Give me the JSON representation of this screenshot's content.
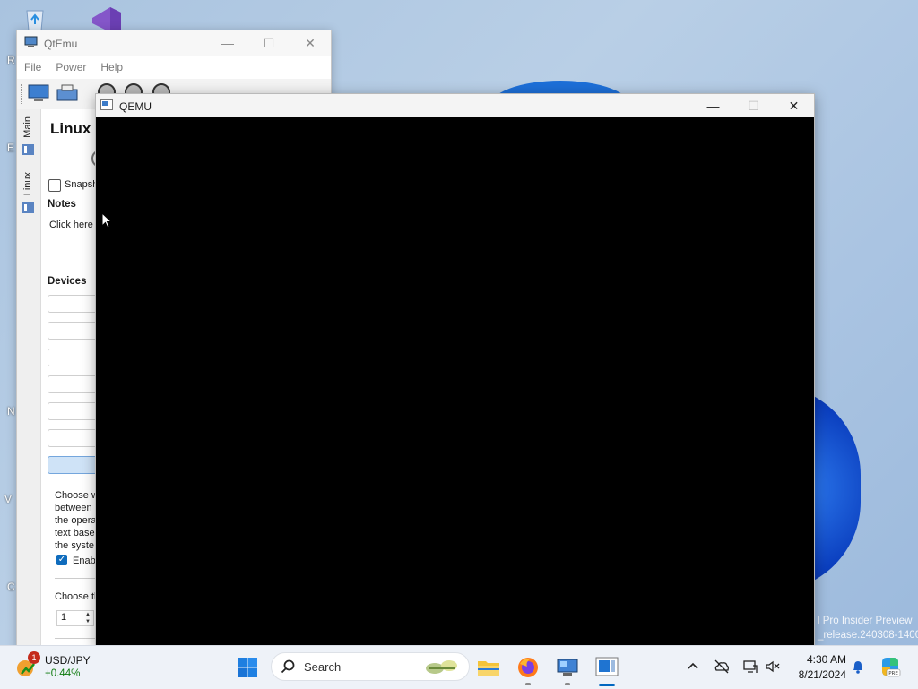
{
  "desktop": {
    "icon_letters": [
      "R",
      "E",
      "N",
      "V",
      "C"
    ],
    "watermark_line1": "l Pro Insider Preview",
    "watermark_line2": "_release.240308-1400"
  },
  "qtemu": {
    "title": "QtEmu",
    "menu": [
      "File",
      "Power",
      "Help"
    ],
    "side_tabs": [
      "Main",
      "Linux"
    ],
    "machine_name": "Linux",
    "snapshot_label": "Snapsh",
    "notes_label": "Notes",
    "notes_text": "Click here t",
    "devices_label": "Devices",
    "choose_text": [
      "Choose w",
      "between",
      "the opera",
      "text base",
      "the syste"
    ],
    "enable_label": "Enabl",
    "choose2_label": "Choose th",
    "spin_value": "1"
  },
  "qemu": {
    "title": "QEMU"
  },
  "taskbar": {
    "widget_badge": "1",
    "widget_name": "USD/JPY",
    "widget_change": "+0.44%",
    "search_placeholder": "Search",
    "time": "4:30 AM",
    "date": "8/21/2024"
  },
  "colors": {
    "accent": "#0067c0",
    "qemu_screen": "#000000",
    "positive": "#0f7b0f",
    "badge": "#c42b1c"
  }
}
